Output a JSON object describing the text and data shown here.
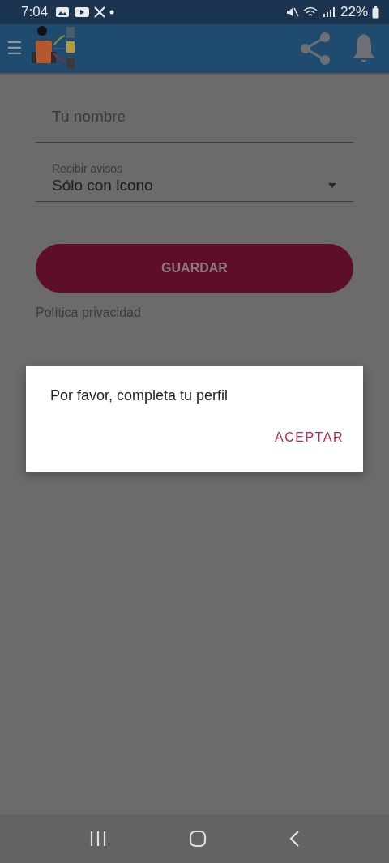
{
  "status_bar": {
    "time": "7:04",
    "battery": "22%"
  },
  "app_bar": {
    "menu_glyph": "☰"
  },
  "form": {
    "name_field": {
      "placeholder": "Tu nombre"
    },
    "notify_select": {
      "label": "Recibir avisos",
      "value": "Sólo con icono"
    },
    "save_button": "GUARDAR",
    "privacy_link": "Política privacidad"
  },
  "dialog": {
    "message": "Por favor, completa tu perfil",
    "action": "ACEPTAR"
  }
}
